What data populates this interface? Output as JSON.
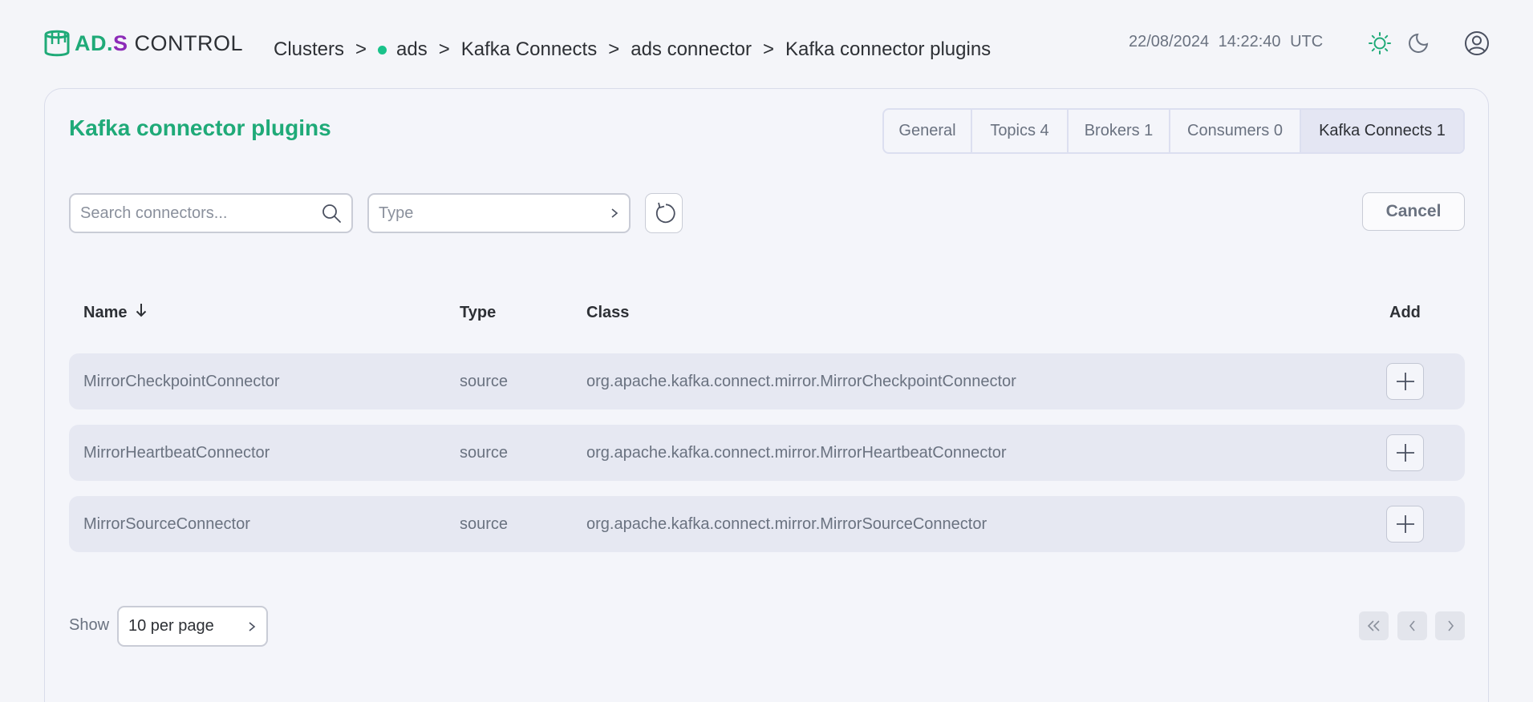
{
  "logo": {
    "ad": "AD",
    "dot": ".",
    "s": "S",
    "control": "CONTROL"
  },
  "breadcrumb": [
    {
      "label": "Clusters"
    },
    {
      "label": "ads",
      "status_color": "#19c28a"
    },
    {
      "label": "Kafka Connects"
    },
    {
      "label": "ads connector"
    },
    {
      "label": "Kafka connector plugins"
    }
  ],
  "breadcrumb_separator": ">",
  "header": {
    "date": "22/08/2024",
    "time": "14:22:40",
    "timezone": "UTC",
    "icons": [
      "sun-icon",
      "moon-icon",
      "user-icon"
    ]
  },
  "page": {
    "title": "Kafka connector plugins",
    "tabs": [
      {
        "label": "General",
        "active": false
      },
      {
        "label": "Topics 4",
        "active": false
      },
      {
        "label": "Brokers 1",
        "active": false
      },
      {
        "label": "Consumers 0",
        "active": false
      },
      {
        "label": "Kafka Connects 1",
        "active": true
      }
    ]
  },
  "toolbar": {
    "search_placeholder": "Search connectors...",
    "type_placeholder": "Type",
    "cancel_label": "Cancel"
  },
  "table": {
    "columns": {
      "name": "Name",
      "type": "Type",
      "class": "Class",
      "add": "Add"
    },
    "sort_icon": "arrow-down-icon",
    "rows": [
      {
        "name": "MirrorCheckpointConnector",
        "type": "source",
        "class": "org.apache.kafka.connect.mirror.MirrorCheckpointConnector"
      },
      {
        "name": "MirrorHeartbeatConnector",
        "type": "source",
        "class": "org.apache.kafka.connect.mirror.MirrorHeartbeatConnector"
      },
      {
        "name": "MirrorSourceConnector",
        "type": "source",
        "class": "org.apache.kafka.connect.mirror.MirrorSourceConnector"
      }
    ]
  },
  "pagination": {
    "show_label": "Show",
    "per_page": "10 per page"
  },
  "colors": {
    "accent": "#1faa78",
    "brand_purple": "#8c2bb8",
    "status_online": "#19c28a"
  }
}
